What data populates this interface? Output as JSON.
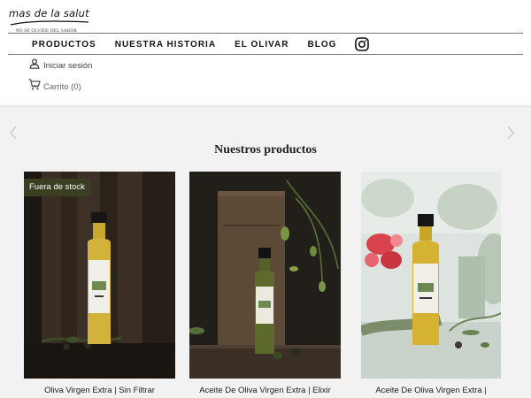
{
  "brand": {
    "name": "mas de la salut",
    "tagline": "No se olvide del sabor"
  },
  "nav": {
    "items": [
      {
        "label": "PRODUCTOS"
      },
      {
        "label": "NUESTRA HISTORIA"
      },
      {
        "label": "EL OLIVAR"
      },
      {
        "label": "BLOG"
      }
    ],
    "social_icon": "instagram-icon"
  },
  "account": {
    "signin_label": "Iniciar sesión",
    "signin_icon": "user-icon"
  },
  "cart": {
    "label": "Carrito (0)",
    "icon": "cart-icon"
  },
  "carousel": {
    "prev_icon": "chevron-left-icon",
    "next_icon": "chevron-right-icon"
  },
  "products_section": {
    "title": "Nuestros productos",
    "products": [
      {
        "title": "Oliva Virgen Extra | Sin Filtrar",
        "badge": "Fuera de stock"
      },
      {
        "title": "Aceite De Oliva Virgen Extra | Elixir",
        "badge": ""
      },
      {
        "title": "Aceite De Oliva Virgen Extra |",
        "badge": ""
      }
    ]
  },
  "colors": {
    "badge_bg": "#3a3f22",
    "section_bg": "#f2f2f2",
    "rule": "#7a7a7a"
  }
}
